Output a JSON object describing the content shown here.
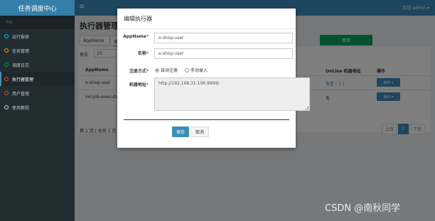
{
  "app": {
    "title": "任务调度中心"
  },
  "sidebar": {
    "header": "导航",
    "items": [
      {
        "label": "运行报表",
        "color": "aqua"
      },
      {
        "label": "任务管理",
        "color": "yellow"
      },
      {
        "label": "调度日志",
        "color": "green"
      },
      {
        "label": "执行器管理",
        "color": "red",
        "active": true
      },
      {
        "label": "用户管理",
        "color": "red"
      },
      {
        "label": "使用教程",
        "color": "gray"
      }
    ]
  },
  "topbar": {
    "menu_icon": "≡",
    "user": "欢迎 admin ▾"
  },
  "page": {
    "title": "执行器管理",
    "filter_appname": "AppName",
    "filter_title": "名称",
    "add_button": "新增",
    "per_page_label": "每页",
    "per_page_value": "10",
    "columns": [
      "AppName",
      "OnLine 机器地址",
      "操作"
    ],
    "rows": [
      {
        "appname": "e-shop-user",
        "online": "查看 ( 1 )",
        "op": "操作 ▾"
      },
      {
        "appname": "xxl-job-executor",
        "online": "无",
        "op": "操作 ▾"
      }
    ],
    "page_info": "第 1 页 ( 总共 1 页",
    "pager": [
      "上页",
      "1",
      "下页"
    ]
  },
  "modal": {
    "title": "编辑执行器",
    "appname_label": "AppName",
    "appname_value": "e-shop-user",
    "name_label": "名称",
    "name_value": "e-shop-user",
    "register_label": "注册方式",
    "register_auto": "自动注册",
    "register_manual": "手动录入",
    "address_label": "机器地址",
    "address_value": "http://192.168.31.106:9999/",
    "save": "保存",
    "cancel": "取消"
  },
  "watermark": "CSDN @南秋同学"
}
